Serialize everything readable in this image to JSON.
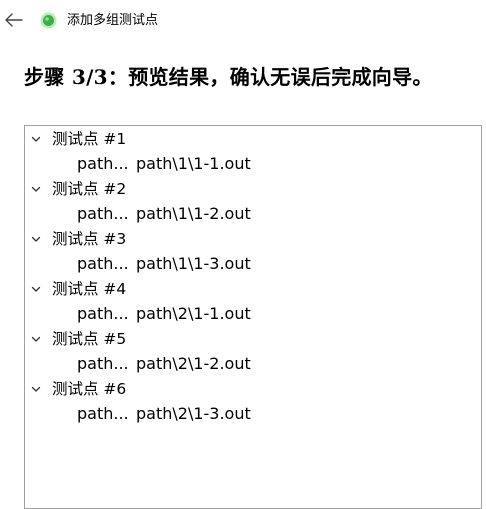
{
  "window": {
    "title": "添加多组测试点",
    "back_icon": "arrow-left-icon",
    "app_icon": "green-circle-icon",
    "accent": "#3cb043"
  },
  "heading": "步骤 3/3：预览结果，确认无误后完成向导。",
  "tree": {
    "nodes": [
      {
        "label": "测试点 #1",
        "child_a": "path...",
        "child_b": "path\\1\\1-1.out"
      },
      {
        "label": "测试点 #2",
        "child_a": "path...",
        "child_b": "path\\1\\1-2.out"
      },
      {
        "label": "测试点 #3",
        "child_a": "path...",
        "child_b": "path\\1\\1-3.out"
      },
      {
        "label": "测试点 #4",
        "child_a": "path...",
        "child_b": "path\\2\\1-1.out"
      },
      {
        "label": "测试点 #5",
        "child_a": "path...",
        "child_b": "path\\2\\1-2.out"
      },
      {
        "label": "测试点 #6",
        "child_a": "path...",
        "child_b": "path\\2\\1-3.out"
      }
    ]
  }
}
